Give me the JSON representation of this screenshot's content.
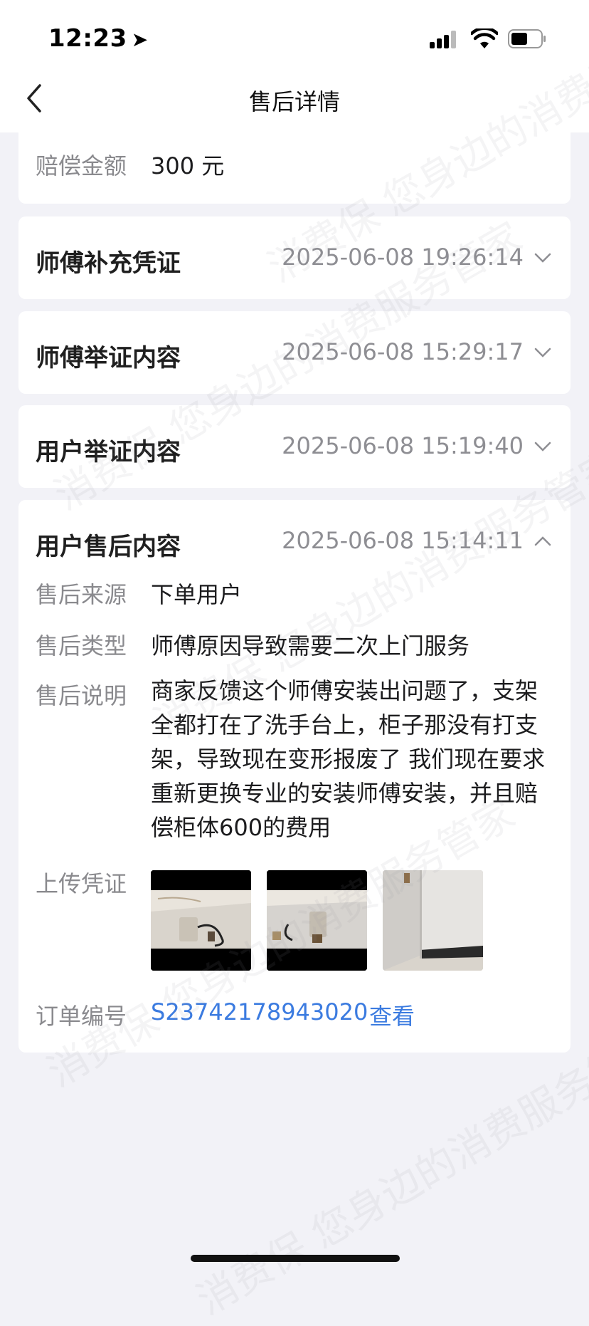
{
  "status_bar": {
    "time": "12:23"
  },
  "nav": {
    "title": "售后详情"
  },
  "compensation": {
    "label": "赔偿金额",
    "value": "300 元"
  },
  "sections": [
    {
      "title": "师傅补充凭证",
      "time": "2025-06-08 19:26:14",
      "expanded": false
    },
    {
      "title": "师傅举证内容",
      "time": "2025-06-08 15:29:17",
      "expanded": false
    },
    {
      "title": "用户举证内容",
      "time": "2025-06-08 15:19:40",
      "expanded": false
    }
  ],
  "detail": {
    "title": "用户售后内容",
    "time": "2025-06-08 15:14:11",
    "source_label": "售后来源",
    "source_value": "下单用户",
    "type_label": "售后类型",
    "type_value": "师傅原因导致需要二次上门服务",
    "desc_label": "售后说明",
    "desc_value": "商家反馈这个师傅安装出问题了，支架全都打在了洗手台上，柜子那没有打支架，导致现在变形报废了 我们现在要求重新更换专业的安装师傅安装，并且赔偿柜体600的费用",
    "upload_label": "上传凭证",
    "order_label": "订单编号",
    "order_no": "S23742178943020",
    "order_view": "查看"
  },
  "watermark": "消费保 您身边的消费服务管家"
}
